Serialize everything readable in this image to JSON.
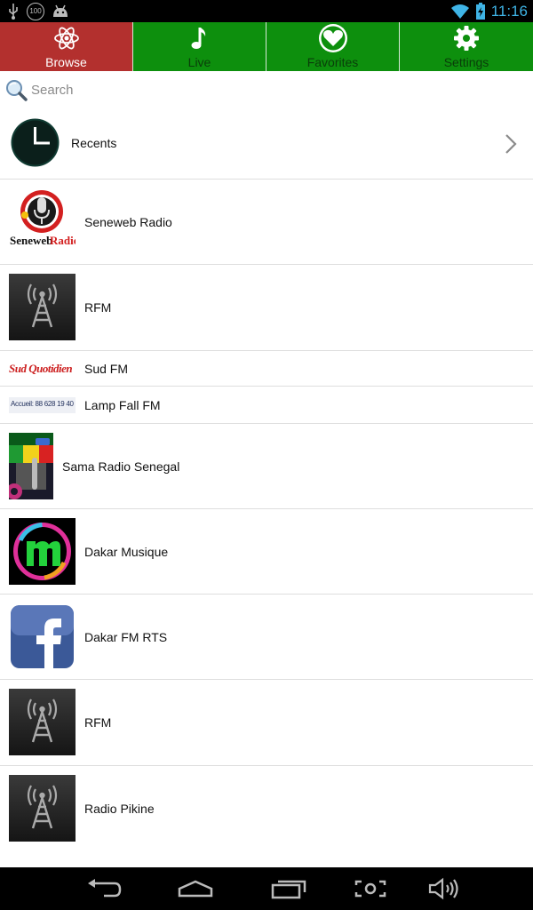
{
  "status_bar": {
    "time": "11:16",
    "notification_badge": "100",
    "icons": [
      "usb-icon",
      "notification-count-icon",
      "android-icon",
      "wifi-icon",
      "battery-charging-icon"
    ]
  },
  "tabs": [
    {
      "label": "Browse",
      "icon": "atom-icon",
      "active": true,
      "color": "#b3302e"
    },
    {
      "label": "Live",
      "icon": "music-note-icon",
      "active": false,
      "color": "#0d8f0d"
    },
    {
      "label": "Favorites",
      "icon": "heart-icon",
      "active": false,
      "color": "#0d8f0d"
    },
    {
      "label": "Settings",
      "icon": "gear-icon",
      "active": false,
      "color": "#0d8f0d"
    }
  ],
  "search": {
    "placeholder": "Search"
  },
  "recents": {
    "label": "Recents",
    "icon": "clock-icon"
  },
  "stations": [
    {
      "name": "Seneweb Radio",
      "logo": "seneweb-logo"
    },
    {
      "name": "RFM",
      "logo": "radio-tower-icon"
    },
    {
      "name": "Sud FM",
      "logo": "sud-quotidien-logo",
      "logo_text": "Sud Quotidien"
    },
    {
      "name": "Lamp Fall FM",
      "logo": "lamp-fall-banner",
      "logo_text": "Accueil: 88 628 19 40"
    },
    {
      "name": "Sama Radio Senegal",
      "logo": "sama-radio-logo"
    },
    {
      "name": "Dakar Musique",
      "logo": "dakar-musique-logo"
    },
    {
      "name": "Dakar FM RTS",
      "logo": "facebook-logo"
    },
    {
      "name": "RFM",
      "logo": "radio-tower-icon"
    },
    {
      "name": "Radio Pikine",
      "logo": "radio-tower-icon"
    }
  ],
  "nav": [
    "back-icon",
    "home-icon",
    "recent-apps-icon",
    "screenshot-icon",
    "volume-icon"
  ]
}
